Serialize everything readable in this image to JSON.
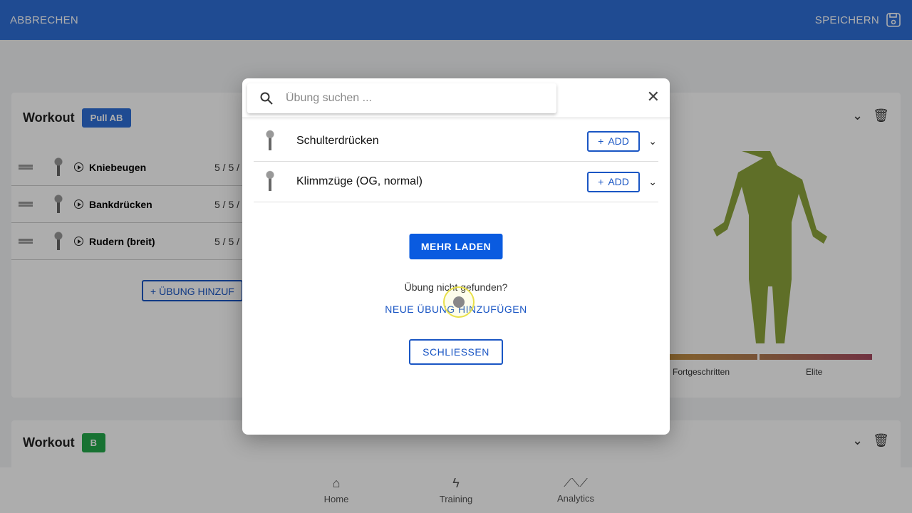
{
  "topbar": {
    "cancel": "ABBRECHEN",
    "save": "SPEICHERN",
    "save_icon": "floppy-disk-icon"
  },
  "workouts": [
    {
      "label": "Workout",
      "badge": "Pull AB",
      "badge_color": "#2f6fd8",
      "exercises": [
        {
          "name": "Kniebeugen",
          "sets": "5 / 5 /"
        },
        {
          "name": "Bankdrücken",
          "sets": "5 / 5 /"
        },
        {
          "name": "Rudern (breit)",
          "sets": "5 / 5 /"
        }
      ],
      "add_button": "ÜBUNG HINZUF",
      "levels": [
        "Fortgeschritten",
        "Elite"
      ]
    },
    {
      "label": "Workout",
      "badge": "B",
      "badge_color": "#22a84a"
    }
  ],
  "modal": {
    "search_placeholder": "Übung suchen ...",
    "results": [
      {
        "name": "Schulterdrücken",
        "add": "ADD"
      },
      {
        "name": "Klimmzüge (OG, normal)",
        "add": "ADD"
      }
    ],
    "load_more": "MEHR LADEN",
    "not_found": "Übung nicht gefunden?",
    "add_new": "NEUE ÜBUNG HINZUFÜGEN",
    "close": "SCHLIESSEN",
    "accent": "#0a5be0"
  },
  "bottom_nav": [
    {
      "label": "Home",
      "icon": "home-icon"
    },
    {
      "label": "Training",
      "icon": "lightning-icon"
    },
    {
      "label": "Analytics",
      "icon": "trend-icon"
    }
  ]
}
